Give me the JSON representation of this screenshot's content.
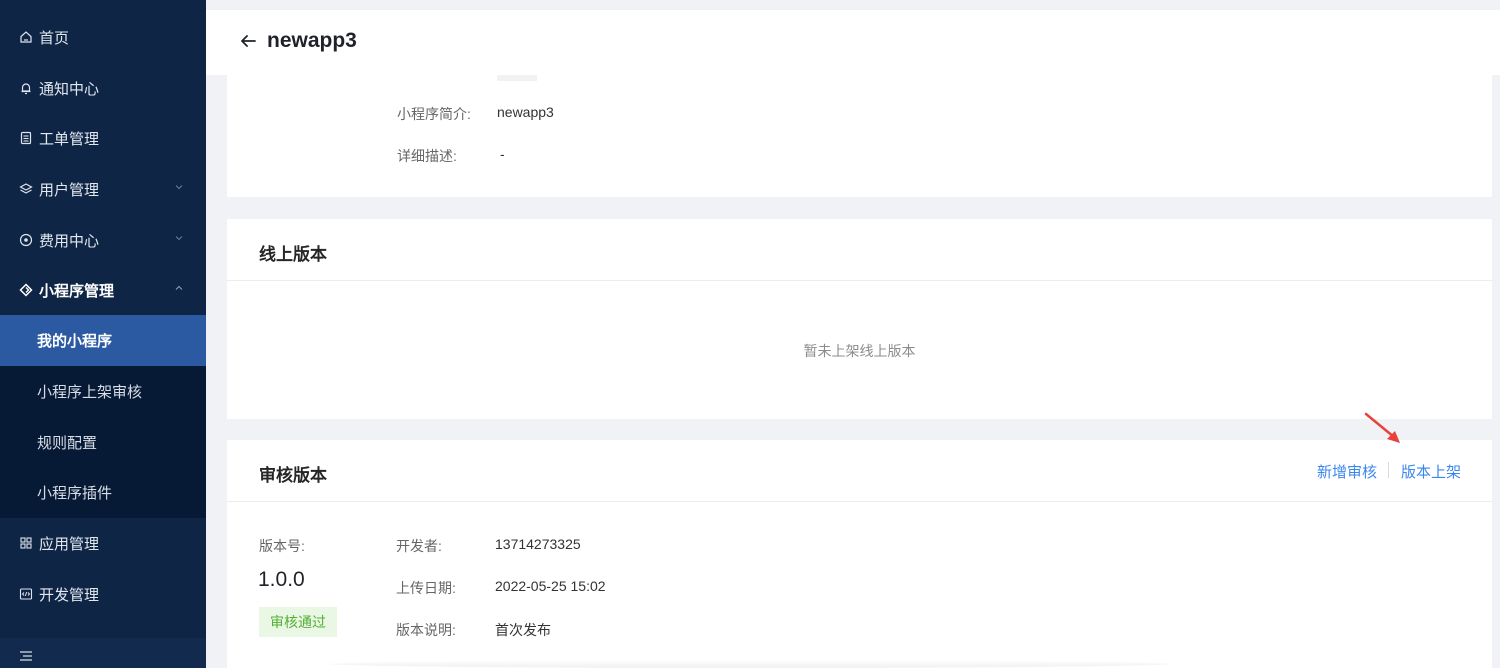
{
  "sidebar": {
    "items": [
      {
        "label": "首页",
        "icon": "home-icon"
      },
      {
        "label": "通知中心",
        "icon": "bell-icon"
      },
      {
        "label": "工单管理",
        "icon": "document-icon"
      },
      {
        "label": "用户管理",
        "icon": "layers-icon"
      },
      {
        "label": "费用中心",
        "icon": "circle-dot-icon"
      },
      {
        "label": "小程序管理",
        "icon": "diamond-icon"
      },
      {
        "label": "应用管理",
        "icon": "grid-icon"
      },
      {
        "label": "开发管理",
        "icon": "code-icon"
      }
    ],
    "submenu": [
      {
        "label": "我的小程序"
      },
      {
        "label": "小程序上架审核"
      },
      {
        "label": "规则配置"
      },
      {
        "label": "小程序插件"
      }
    ]
  },
  "header": {
    "title": "newapp3"
  },
  "info": {
    "intro_label": "小程序简介:",
    "intro_value": "newapp3",
    "detail_label": "详细描述:",
    "detail_value": "-"
  },
  "online": {
    "title": "线上版本",
    "empty": "暂未上架线上版本"
  },
  "review": {
    "title": "审核版本",
    "actions": {
      "add": "新增审核",
      "publish": "版本上架"
    },
    "version_label": "版本号:",
    "version": "1.0.0",
    "status": "审核通过",
    "developer_label": "开发者:",
    "developer": "13714273325",
    "upload_label": "上传日期:",
    "upload_date": "2022-05-25 15:02",
    "desc_label": "版本说明:",
    "desc": "首次发布"
  },
  "colors": {
    "sidebar_bg": "#0f2546",
    "active_item": "#2b5aa3",
    "link": "#3b86ed",
    "status_green": "#52b035",
    "annotation_red": "#e8433b"
  }
}
